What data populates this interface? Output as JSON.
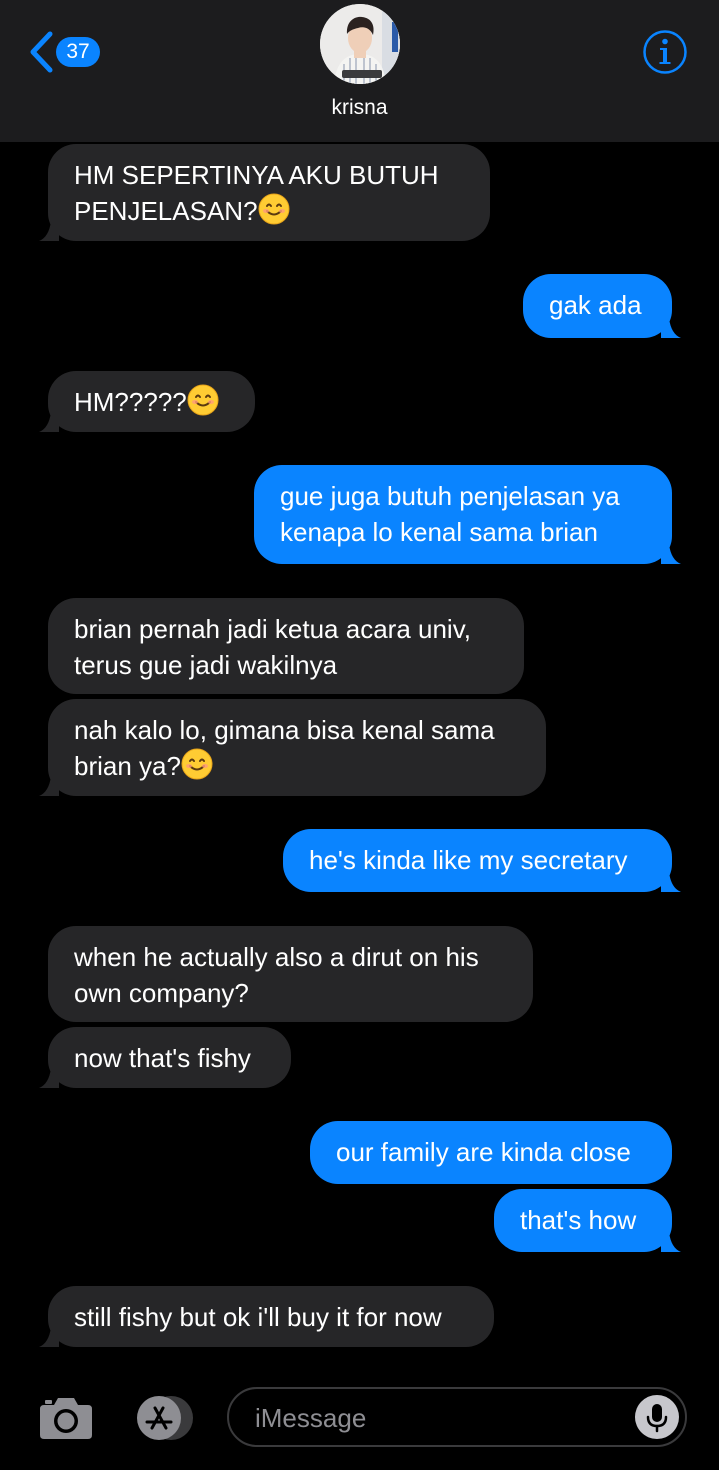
{
  "header": {
    "back_count": "37",
    "contact_name": "krisna",
    "accent_color": "#0a84ff"
  },
  "messages": [
    {
      "side": "incoming",
      "lines": [
        "HM SEPERTINYA AKU BUTUH",
        "PENJELASAN?"
      ],
      "emoji": "smiling-face-icon"
    },
    {
      "side": "outgoing",
      "lines": [
        "gak ada"
      ]
    },
    {
      "side": "incoming",
      "lines": [
        "HM?????"
      ],
      "emoji": "smiling-face-icon"
    },
    {
      "side": "outgoing",
      "lines": [
        "gue juga butuh penjelasan ya",
        "kenapa lo kenal sama brian"
      ]
    },
    {
      "side": "incoming",
      "lines": [
        "brian pernah jadi ketua acara univ,",
        "terus gue jadi wakilnya"
      ]
    },
    {
      "side": "incoming",
      "lines": [
        "nah kalo lo, gimana bisa kenal sama",
        "brian ya?"
      ],
      "emoji": "smiling-face-icon"
    },
    {
      "side": "outgoing",
      "lines": [
        "he's kinda like my secretary"
      ]
    },
    {
      "side": "incoming",
      "lines": [
        "when he actually also a dirut on his",
        "own company?"
      ]
    },
    {
      "side": "incoming",
      "lines": [
        "now that's fishy"
      ]
    },
    {
      "side": "outgoing",
      "lines": [
        "our family are kinda close"
      ]
    },
    {
      "side": "outgoing",
      "lines": [
        "that's how"
      ]
    },
    {
      "side": "incoming",
      "lines": [
        "still fishy but ok i'll buy it for now"
      ]
    }
  ],
  "composer": {
    "placeholder": "iMessage",
    "icons": [
      "camera-icon",
      "app-store-icon",
      "microphone-icon"
    ]
  },
  "colors": {
    "incoming_bubble": "#262628",
    "outgoing_bubble": "#0a84ff",
    "background": "#000000"
  }
}
